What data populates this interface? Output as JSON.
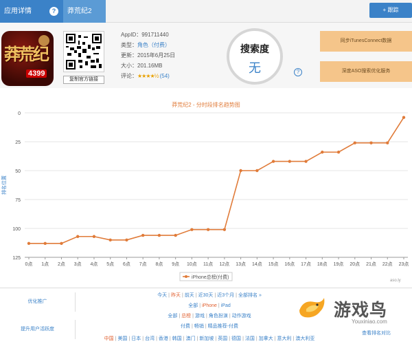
{
  "header": {
    "tab_detail": "应用详情",
    "help": "?",
    "tab_name": "莽荒纪2",
    "track_button": "+ 跟踪"
  },
  "app": {
    "icon_text_main": "莽荒纪",
    "icon_text_badge": "4399",
    "qr_link": "复制官方链接",
    "appid_label": "AppID：",
    "appid": "991711440",
    "type_label": "类型：",
    "type": "角色（付费）",
    "updated_label": "更新：",
    "updated": "2015年6月25日",
    "size_label": "大小：",
    "size": "201.16MB",
    "rating_label": "评论：",
    "rating_stars": "★★★★½",
    "rating_count": "(54)",
    "rating_value": 4.5,
    "search_label": "搜索度",
    "search_value": "无",
    "btn_itunes": "同步iTunesConnect数据",
    "btn_aso": "深度ASO搜索优化服务"
  },
  "chart_data": {
    "type": "line",
    "title": "莽荒纪2 - 分时段排名趋势图",
    "ylabel": "排名位置",
    "xlabel": "",
    "ylim": [
      125,
      0
    ],
    "y_reversed": true,
    "y_ticks": [
      "0",
      "25",
      "50",
      "75",
      "100",
      "125"
    ],
    "x_labels": [
      "0点",
      "1点",
      "2点",
      "3点",
      "4点",
      "5点",
      "6点",
      "7点",
      "8点",
      "9点",
      "10点",
      "11点",
      "12点",
      "13点",
      "14点",
      "15点",
      "16点",
      "17点",
      "18点",
      "19点",
      "20点",
      "21点",
      "22点",
      "23点"
    ],
    "categories": [
      "0点",
      "1点",
      "2点",
      "3点",
      "4点",
      "5点",
      "6点",
      "7点",
      "8点",
      "9点",
      "10点",
      "11点",
      "12点",
      "13点",
      "14点",
      "15点",
      "16点",
      "17点",
      "18点",
      "19点",
      "20点",
      "21点",
      "22点",
      "23点"
    ],
    "series": [
      {
        "name": "iPhone总榜(付费)",
        "values": [
          113,
          113,
          113,
          107,
          107,
          110,
          110,
          106,
          106,
          106,
          101,
          101,
          101,
          50,
          50,
          42,
          42,
          42,
          34,
          34,
          26,
          26,
          26,
          4
        ]
      }
    ],
    "legend": "iPhone总榜(付费)",
    "legend_position": "bottom",
    "grid": true,
    "line_color": "#e07b39",
    "source": "aso.ly"
  },
  "filters": {
    "side_label_1": "优化推广",
    "side_label_2": "提升用户活跃度",
    "row1": [
      "今天",
      "昨天",
      "前天",
      "近30天",
      "近3个月",
      "全部排名 »"
    ],
    "row1_selected": "昨天",
    "row2": [
      "全部",
      "iPhone",
      "iPad"
    ],
    "row2_selected": "iPhone",
    "row3": [
      "全部",
      "总榜",
      "游戏",
      "角色扮演",
      "动作游戏"
    ],
    "row3_selected": "总榜",
    "row3b": [
      "付费",
      "畅销",
      "精品推荐-付费"
    ],
    "row4": [
      "中国",
      "美国",
      "日本",
      "台湾",
      "香港",
      "韩国",
      "澳门",
      "新加坡",
      "英国",
      "德国",
      "法国",
      "加拿大",
      "意大利",
      "澳大利亚"
    ],
    "row4_selected": "中国",
    "right_label": "查看排名对比",
    "logo_text": "游戏鸟",
    "logo_url": "Youxiniao.com"
  }
}
